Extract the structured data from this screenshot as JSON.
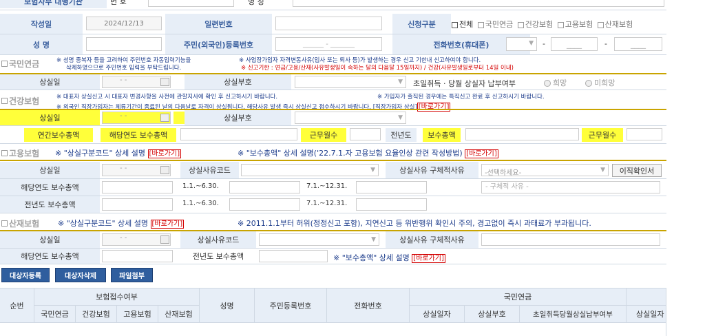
{
  "top": {
    "label_partial": "보험사무 대행기관",
    "field_label": "번 호",
    "field2_label": "명 칭"
  },
  "row1": {
    "author_label": "작성일",
    "date_value": "2024/12/13",
    "serial_label": "일련번호",
    "apply_label": "신청구분",
    "checks": [
      "전체",
      "국민연금",
      "건강보험",
      "고용보험",
      "산재보험"
    ]
  },
  "row2": {
    "name_label": "성 명",
    "rrn_label": "주민(외국인)등록번호",
    "rrn_placeholder": "______ - _______",
    "phone_label": "전화번호(휴대폰)",
    "dash1": "-",
    "dash2": "-",
    "ph2": "____",
    "ph3": "____"
  },
  "pension": {
    "title": "국민연금",
    "note1": "※ 성명 중복자 등을 고려하여 주민번호 자동입력기능을",
    "note1b": "삭제하였으므로 주민번호 입력을 부탁드립니다.",
    "note2": "※ 사업장가입자 자격변동사유(입사 또는 퇴사 등)가 발생하는 경우 신고 기한내 신고하여야 합니다.",
    "note2b": "※ 신고기한 : 연금/고용/산재(사유발생일이 속하는 달의 다음달 15일까지) / 건강(사유발생일로부터 14일 이내)",
    "loss_date": "상실일",
    "date_ph": "-  -",
    "loss_code": "상실부호",
    "first_day": "초일취득 · 당월 상실자 납부여부",
    "opt1": "희망",
    "opt2": "미희망"
  },
  "health": {
    "title": "건강보험",
    "note1": "※ 대표자 상실신고 시 대표자 변경사항을 사전에 관할지사에 확인 후 신고하시기 바랍니다.",
    "note1b": "※ 가입자가 출직된 경우에는 특직신고 완료 후 신고하시기 바랍니다.",
    "note2": "※ 외국인 직장가입자는 체류기간이 종료된 날의 다음날로 자격이 상실됩니다. 해당사유 발생 즉시 상실신고 접수하시기 바랍니다. [직장가입자 상실]",
    "link": "[바로가기]",
    "loss_date": "상실일",
    "date_ph": "-  -",
    "loss_code": "상실부호",
    "annual_total": "연간보수총액",
    "year_total": "해당연도 보수총액",
    "months": "근무월수",
    "prev_year": "전년도",
    "prev_total": "보수총액",
    "months2": "근무월수"
  },
  "employment": {
    "title": "고용보험",
    "note1": "※ \"상실구분코드\" 상세 설명",
    "link1": "[바로가기]",
    "note2": "※ \"보수총액\" 상세 설명('22.7.1.자 고용보험 요율인상 관련 작성방법)",
    "link2": "[바로가기]",
    "loss_date": "상실일",
    "date_ph": "-  -",
    "reason_code": "상실사유코드",
    "reason_detail": "상실사유 구체적사유",
    "select_ph": "-선택하세요-",
    "verify_btn": "이직확인서",
    "year_total": "해당연도 보수총액",
    "prev_total": "전년도 보수총액",
    "period1": "1.1.~6.30.",
    "period2": "7.1.~12.31.",
    "detail_ph": "- 구체적 사유 -"
  },
  "accident": {
    "title": "산재보험",
    "note1": "※ \"상실구분코드\" 상세 설명",
    "link1": "[바로가기]",
    "note2": "※ 2011.1.1부터 허위(정정신고 포함), 지연신고 등 위반행위 확인시 주의, 경고없이 즉시 과태료가 부과됩니다.",
    "loss_date": "상실일",
    "date_ph": "-  -",
    "reason_code": "상실사유코드",
    "reason_detail": "상실사유 구체적사유",
    "year_total": "해당연도 보수총액",
    "prev_total": "전년도 보수총액",
    "note3": "※ \"보수총액\" 상세 설명",
    "link3": "[바로가기]"
  },
  "buttons": {
    "register": "대상자등록",
    "delete": "대상자삭제",
    "attach": "파일첨부"
  },
  "table": {
    "seq": "순번",
    "ins_group": "보험접수여부",
    "ins": [
      "국민연금",
      "건강보험",
      "고용보험",
      "산재보험"
    ],
    "name": "성명",
    "rrn": "주민등록번호",
    "phone": "전화번호",
    "pension_group": "국민연금",
    "pension_cols": [
      "상실일자",
      "상실부호",
      "초일취득당월상실납부여부",
      "상실일자"
    ]
  }
}
